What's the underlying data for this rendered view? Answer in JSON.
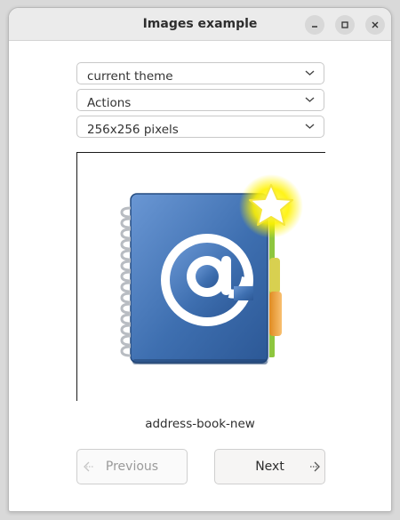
{
  "window": {
    "title": "Images example"
  },
  "controls": {
    "theme": {
      "value": "current theme"
    },
    "context": {
      "value": "Actions"
    },
    "size": {
      "value": "256x256 pixels"
    }
  },
  "image": {
    "icon": "address-book-new-icon",
    "label": "address-book-new"
  },
  "navigation": {
    "previous_label": "Previous",
    "next_label": "Next"
  },
  "colors": {
    "titlebar": "#ebebeb",
    "book_blue": "#3e6fb0",
    "star_yellow": "#fff200",
    "tab_orange": "#f0a030",
    "tab_green": "#8ec63f"
  }
}
